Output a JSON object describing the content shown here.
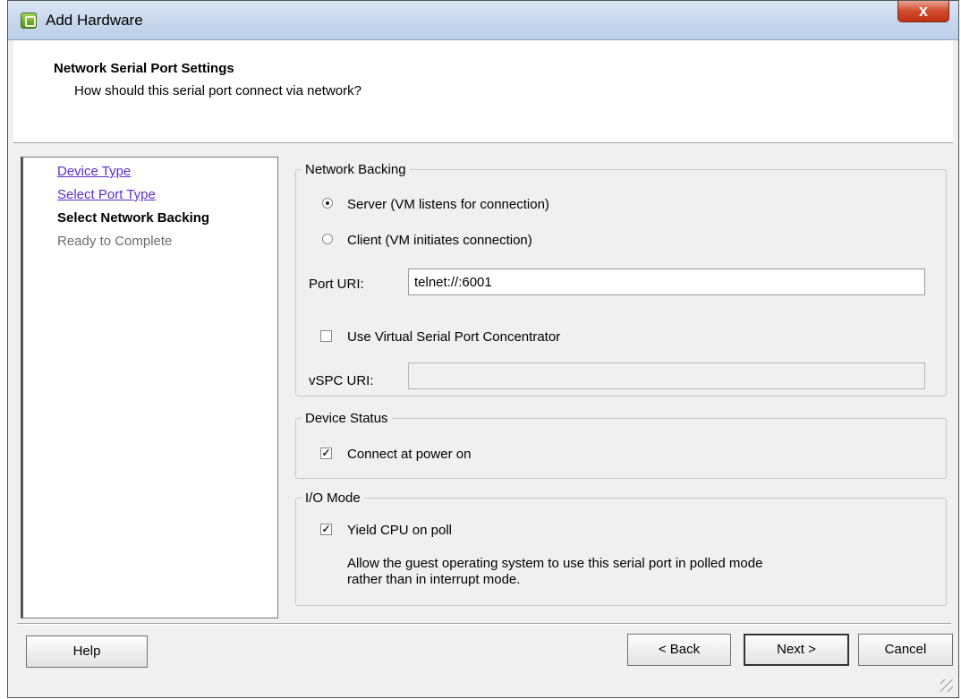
{
  "window": {
    "title": "Add Hardware",
    "close_label": "x"
  },
  "header": {
    "title": "Network Serial Port Settings",
    "subtitle": "How should this serial port connect via network?"
  },
  "steps": [
    {
      "label": "Device Type",
      "state": "link"
    },
    {
      "label": "Select Port Type",
      "state": "link"
    },
    {
      "label": "Select Network Backing",
      "state": "active"
    },
    {
      "label": "Ready to Complete",
      "state": "disabled"
    }
  ],
  "network_backing": {
    "legend": "Network Backing",
    "server_label": "Server (VM listens for connection)",
    "client_label": "Client  (VM initiates connection)",
    "selected": "server",
    "port_uri_label": "Port URI:",
    "port_uri_value": "telnet://:6001",
    "vspc_checkbox_label": "Use Virtual Serial Port Concentrator",
    "vspc_checked": false,
    "vspc_uri_label": "vSPC URI:",
    "vspc_uri_value": ""
  },
  "device_status": {
    "legend": "Device Status",
    "connect_label": "Connect at power on",
    "connect_checked": true
  },
  "io_mode": {
    "legend": "I/O Mode",
    "yield_label": "Yield CPU on poll",
    "yield_checked": true,
    "description_line1": "Allow the guest operating system to use this serial port in polled mode",
    "description_line2": "rather than in interrupt mode."
  },
  "buttons": {
    "help": "Help",
    "back": "< Back",
    "next": "Next >",
    "cancel": "Cancel"
  }
}
